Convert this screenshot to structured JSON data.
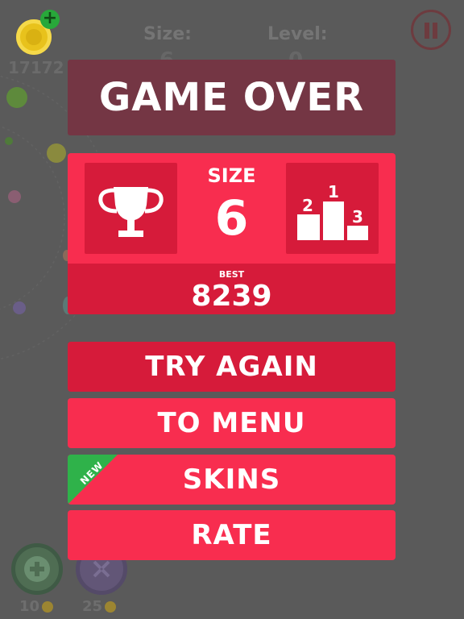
{
  "hud": {
    "coins": "17172",
    "size_label": "Size:",
    "size_value": "6",
    "level_label": "Level:",
    "level_value": "0"
  },
  "overlay": {
    "title": "GAME OVER",
    "score": {
      "size_label": "SIZE",
      "size_value": "6",
      "best_label": "BEST",
      "best_value": "8239",
      "podium_numbers": [
        "1",
        "2",
        "3"
      ]
    },
    "buttons": {
      "try_again": "TRY AGAIN",
      "to_menu": "TO MENU",
      "skins": "SKINS",
      "skins_badge": "NEW",
      "rate": "RATE"
    }
  },
  "bottom_bar": {
    "plus_price": "10",
    "shrink_price": "25"
  },
  "colors": {
    "background": "#5a5a5a",
    "game_over_panel": "#743644",
    "accent_red": "#f82d4f",
    "dark_red": "#d61b3a",
    "new_badge_green": "#2fb24a"
  }
}
